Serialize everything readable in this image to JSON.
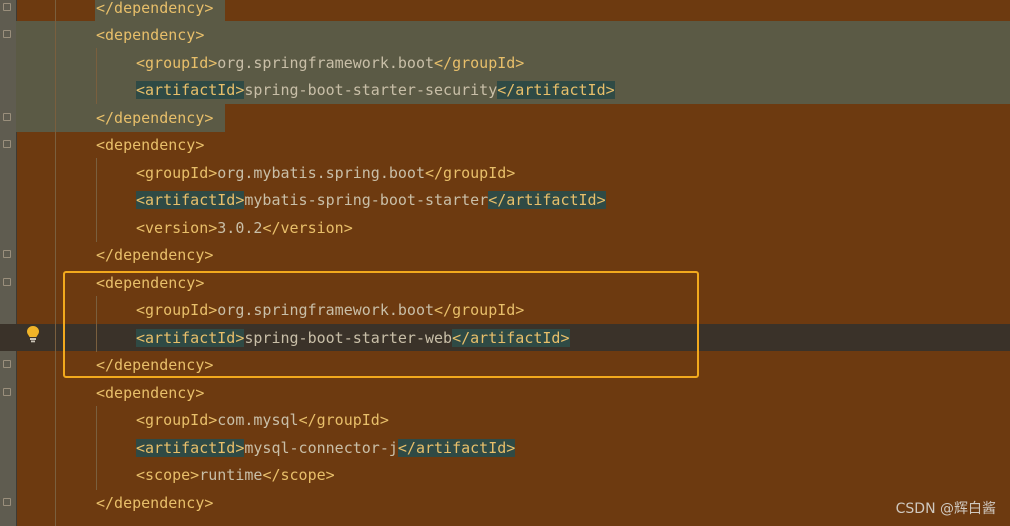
{
  "lines": [
    {
      "indent": 0,
      "segments": [
        {
          "t": "tag",
          "v": "</dependency>"
        }
      ]
    },
    {
      "indent": 0,
      "segments": [
        {
          "t": "tag",
          "v": "<dependency>"
        }
      ]
    },
    {
      "indent": 1,
      "segments": [
        {
          "t": "tag",
          "v": "<groupId>"
        },
        {
          "t": "txt",
          "v": "org.springframework.boot"
        },
        {
          "t": "tag",
          "v": "</groupId>"
        }
      ]
    },
    {
      "indent": 1,
      "segments": [
        {
          "t": "tag hl",
          "v": "<artifactId>"
        },
        {
          "t": "txt",
          "v": "spring-boot-starter-security"
        },
        {
          "t": "tag hl",
          "v": "</artifactId>"
        }
      ]
    },
    {
      "indent": 0,
      "segments": [
        {
          "t": "tag",
          "v": "</dependency>"
        }
      ]
    },
    {
      "indent": 0,
      "segments": [
        {
          "t": "tag",
          "v": "<dependency>"
        }
      ]
    },
    {
      "indent": 1,
      "segments": [
        {
          "t": "tag",
          "v": "<groupId>"
        },
        {
          "t": "txt",
          "v": "org.mybatis.spring.boot"
        },
        {
          "t": "tag",
          "v": "</groupId>"
        }
      ]
    },
    {
      "indent": 1,
      "segments": [
        {
          "t": "tag hl",
          "v": "<artifactId>"
        },
        {
          "t": "txt",
          "v": "mybatis-spring-boot-starter"
        },
        {
          "t": "tag hl",
          "v": "</artifactId>"
        }
      ]
    },
    {
      "indent": 1,
      "segments": [
        {
          "t": "tag",
          "v": "<version>"
        },
        {
          "t": "txt",
          "v": "3.0.2"
        },
        {
          "t": "tag",
          "v": "</version>"
        }
      ]
    },
    {
      "indent": 0,
      "segments": [
        {
          "t": "tag",
          "v": "</dependency>"
        }
      ]
    },
    {
      "indent": 0,
      "segments": [
        {
          "t": "tag",
          "v": "<dependency>"
        }
      ]
    },
    {
      "indent": 1,
      "segments": [
        {
          "t": "tag",
          "v": "<groupId>"
        },
        {
          "t": "txt",
          "v": "org.springframework.boot"
        },
        {
          "t": "tag",
          "v": "</groupId>"
        }
      ]
    },
    {
      "indent": 1,
      "segments": [
        {
          "t": "tag hl",
          "v": "<artifactId>"
        },
        {
          "t": "txt",
          "v": "spring-boot-starter-web"
        },
        {
          "t": "tag hl",
          "v": "</artifactId>"
        }
      ]
    },
    {
      "indent": 0,
      "segments": [
        {
          "t": "tag",
          "v": "</dependency>"
        }
      ]
    },
    {
      "indent": 0,
      "segments": [
        {
          "t": "tag",
          "v": "<dependency>"
        }
      ]
    },
    {
      "indent": 1,
      "segments": [
        {
          "t": "tag",
          "v": "<groupId>"
        },
        {
          "t": "txt",
          "v": "com.mysql"
        },
        {
          "t": "tag",
          "v": "</groupId>"
        }
      ]
    },
    {
      "indent": 1,
      "segments": [
        {
          "t": "tag hl",
          "v": "<artifactId>"
        },
        {
          "t": "txt",
          "v": "mysql-connector-j"
        },
        {
          "t": "tag hl",
          "v": "</artifactId>"
        }
      ]
    },
    {
      "indent": 1,
      "segments": [
        {
          "t": "tag",
          "v": "<scope>"
        },
        {
          "t": "txt",
          "v": "runtime"
        },
        {
          "t": "tag",
          "v": "</scope>"
        }
      ]
    },
    {
      "indent": 0,
      "segments": [
        {
          "t": "tag",
          "v": "</dependency>"
        }
      ]
    }
  ],
  "watermark": "CSDN @辉白酱",
  "icons": {
    "intention": "lightbulb-icon",
    "fold": "fold-marker-icon"
  },
  "colors": {
    "background": "#6d3a10",
    "tag": "#e8bf6a",
    "text": "#c9bfa8",
    "box": "#f2a91d"
  }
}
